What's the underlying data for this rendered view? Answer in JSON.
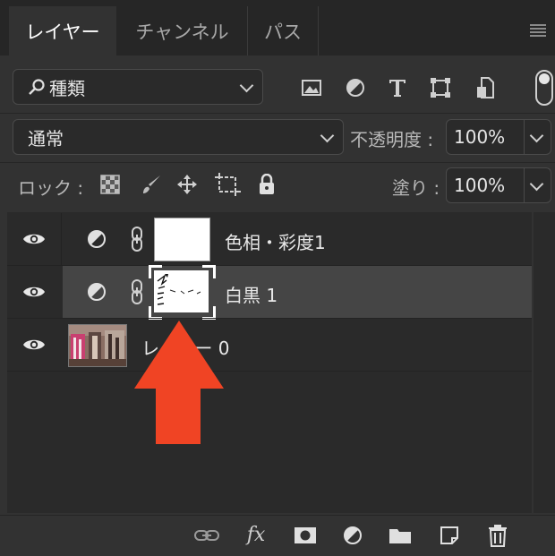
{
  "tabs": [
    {
      "label": "レイヤー",
      "active": true
    },
    {
      "label": "チャンネル",
      "active": false
    },
    {
      "label": "パス",
      "active": false
    }
  ],
  "filter": {
    "label": "種類",
    "icons": [
      "image-filter-icon",
      "adjustment-filter-icon",
      "type-filter-icon",
      "shape-filter-icon",
      "smart-object-filter-icon"
    ]
  },
  "blend": {
    "mode": "通常",
    "opacity_label": "不透明度 :",
    "opacity_value": "100%"
  },
  "lock": {
    "label": "ロック :",
    "fill_label": "塗り :",
    "fill_value": "100%"
  },
  "layers": [
    {
      "name": "色相・彩度1",
      "selected": false
    },
    {
      "name": "白黒 1",
      "selected": true
    },
    {
      "name": "レイヤー 0",
      "selected": false
    }
  ],
  "overlay": {
    "arrow_color": "#f04424"
  },
  "colors": {
    "panel_bg": "#323232",
    "tabbar_bg": "#262626",
    "selected_row": "#454545",
    "list_bg": "#2a2a2a"
  }
}
